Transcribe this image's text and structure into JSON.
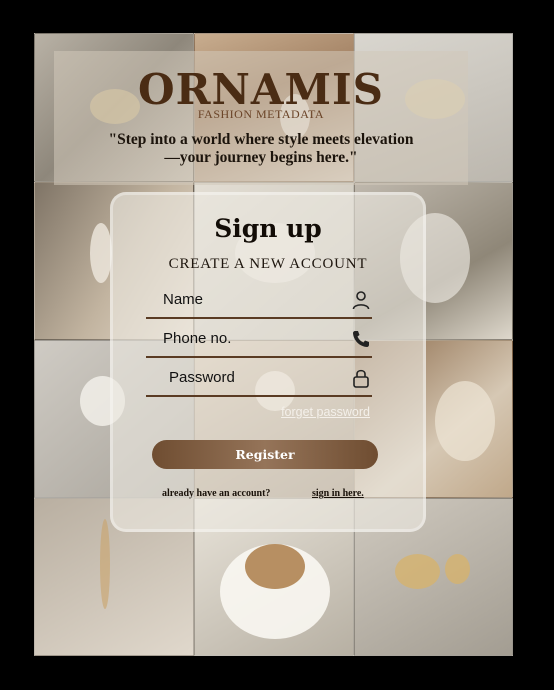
{
  "brand": {
    "name": "ORNAMIS",
    "tagline_small": "FASHION METADATA"
  },
  "header": {
    "quote": "\"Step into a world where style meets elevation\n—your journey begins here.\""
  },
  "form": {
    "title": "Sign up",
    "subtitle": "CREATE A NEW ACCOUNT",
    "fields": [
      {
        "label": "Name",
        "icon": "user-icon"
      },
      {
        "label": "Phone no.",
        "icon": "phone-icon"
      },
      {
        "label": "Password",
        "icon": "lock-icon"
      }
    ],
    "forgot_link": "forget password",
    "register_label": "Register",
    "already_text": "already have an account?",
    "signin_link": "sign in here."
  },
  "colors": {
    "accent": "#6f4d31",
    "brand_text": "#4a2c14",
    "line": "#5a3b23"
  }
}
